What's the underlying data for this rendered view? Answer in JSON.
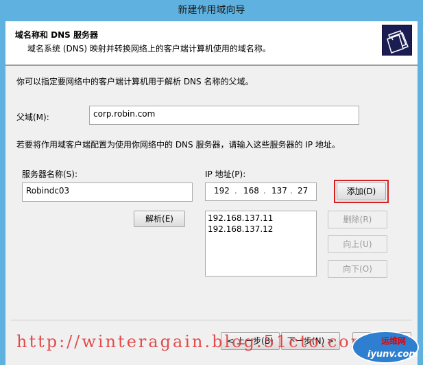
{
  "window": {
    "title": "新建作用域向导"
  },
  "header": {
    "title": "域名称和 DNS 服务器",
    "subtitle": "域名系统 (DNS) 映射并转换网络上的客户端计算机使用的域名称。",
    "icon": "folder-stack-icon"
  },
  "body": {
    "intro": "你可以指定要网络中的客户端计算机用于解析 DNS 名称的父域。",
    "parent_domain_label": "父域(M):",
    "parent_domain_value": "corp.robin.com",
    "config_hint": "若要将作用域客户端配置为使用你网络中的 DNS 服务器，请输入这些服务器的 IP 地址。",
    "server_name_label": "服务器名称(S):",
    "server_name_value": "Robindc03",
    "resolve_button": "解析(E)",
    "ip_label": "IP 地址(P):",
    "ip_octets": [
      "192",
      "168",
      "137",
      "27"
    ],
    "ip_list": [
      "192.168.137.11",
      "192.168.137.12"
    ],
    "add_button": "添加(D)",
    "remove_button": "删除(R)",
    "up_button": "向上(U)",
    "down_button": "向下(O)"
  },
  "footer": {
    "back_button": "< 上一步(B)",
    "next_button": "下一步(N) >",
    "cancel_button": "取消"
  },
  "watermark": {
    "url": "http://winteragain.blog.51cto.com",
    "logo_top": "运维网",
    "logo_bottom": "iyunv.com"
  },
  "colors": {
    "frame": "#5fb1e0",
    "highlight": "#d4201f",
    "watermark": "#e13a3a"
  }
}
